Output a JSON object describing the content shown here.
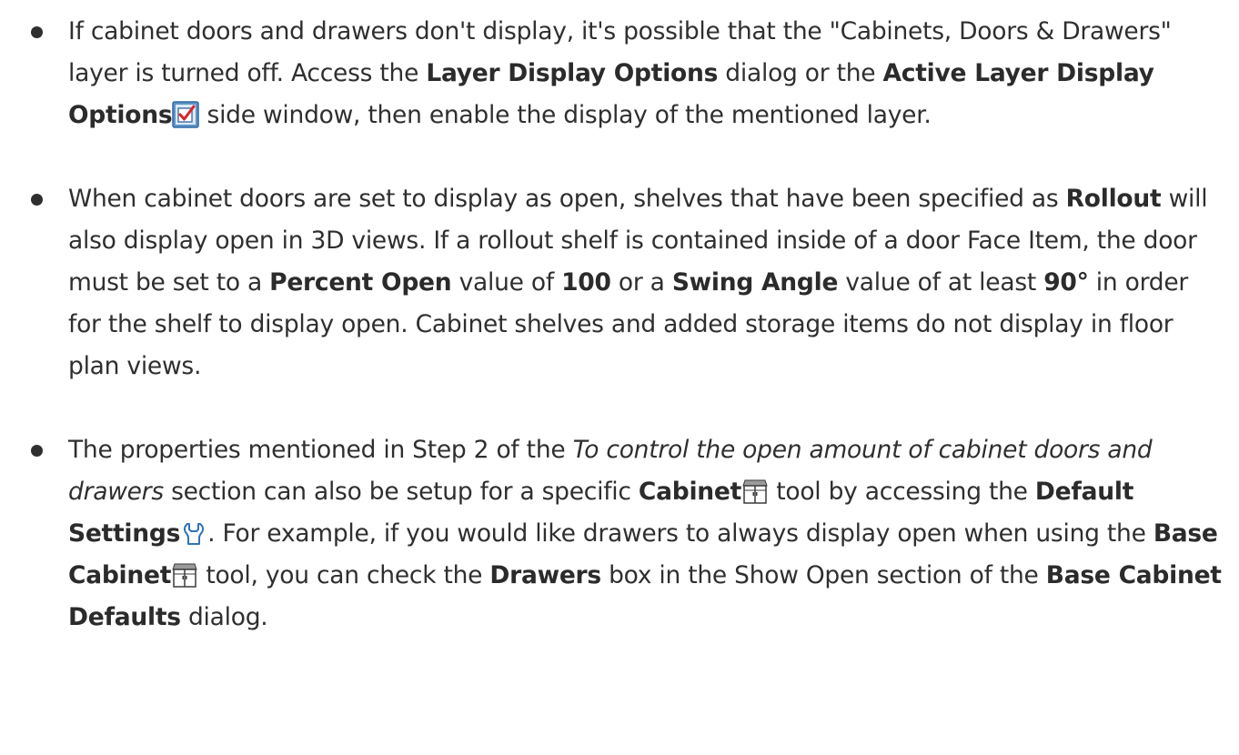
{
  "notes": [
    {
      "a1": "If cabinet doors and drawers don't display, it's possible that the \"Cabinets, Doors & Drawers\" layer is turned off. Access the ",
      "b1": "Layer Display Options",
      "a2": " dialog or the ",
      "b2": "Active Layer Display Options",
      "a3": " side window, then enable the display of the mentioned layer.",
      "icon": "layer-display-checkbox-icon"
    },
    {
      "b1": "Rollout",
      "a1": "When cabinet doors are set to display as open, shelves that have been specified as ",
      "a2": " will also display open in 3D views. If a rollout shelf is contained inside of a door Face Item, the door must be set to a ",
      "b2": "Percent Open",
      "a3": " value of ",
      "b3": "100",
      "a4": " or a ",
      "b4": "Swing Angle",
      "a5": " value of at least ",
      "b5": "90°",
      "a6": " in order for the shelf to display open. Cabinet shelves and added storage items do not display in floor plan views."
    },
    {
      "a1": "The properties mentioned in Step 2 of the ",
      "i1": "To control the open amount of cabinet doors and drawers",
      "a2": " section can also be setup for a specific ",
      "b1": "Cabinet",
      "a3": " tool by accessing the ",
      "b2": "Default Settings",
      "a4": ". For example, if you would like drawers to always display open when using the ",
      "b3": "Base Cabinet",
      "a5": " tool, you can check the ",
      "b4": "Drawers",
      "a6": " box in the Show Open section of the ",
      "b5": "Base Cabinet Defaults",
      "a7": " dialog.",
      "icons": [
        "cabinet-icon",
        "default-settings-icon",
        "base-cabinet-icon"
      ]
    }
  ]
}
